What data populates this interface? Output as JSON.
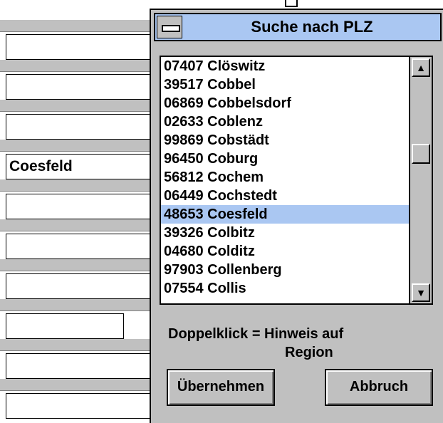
{
  "dialog": {
    "title": "Suche nach PLZ",
    "list": {
      "items": [
        "07407 Clöswitz",
        "39517 Cobbel",
        "06869 Cobbelsdorf",
        "02633 Coblenz",
        "99869 Cobstädt",
        "96450 Coburg",
        "56812 Cochem",
        "06449 Cochstedt",
        "48653 Coesfeld",
        "39326 Colbitz",
        "04680 Colditz",
        "97903 Collenberg",
        "07554 Collis"
      ],
      "selected_index": 8
    },
    "hint_line1": "Doppelklick = Hinweis auf",
    "hint_line2": "Region",
    "ok_label": "Übernehmen",
    "cancel_label": "Abbruch"
  },
  "background_form": {
    "fields": [
      "",
      "",
      "",
      "Coesfeld",
      "",
      "",
      "",
      "",
      "",
      ""
    ]
  },
  "colors": {
    "selection": "#aac7f2",
    "face": "#c0c0c0"
  }
}
